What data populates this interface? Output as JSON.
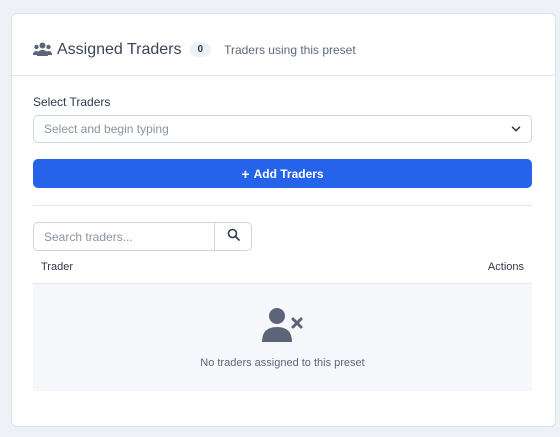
{
  "header": {
    "title": "Assigned Traders",
    "count": "0",
    "subtitle": "Traders using this preset",
    "icon": "users-icon"
  },
  "select_traders": {
    "label": "Select Traders",
    "placeholder": "Select and begin typing",
    "icon": "chevron-down-icon"
  },
  "add_button": {
    "label": "Add Traders",
    "icon": "plus-icon",
    "color": "#2563eb"
  },
  "search": {
    "placeholder": "Search traders...",
    "icon": "search-icon"
  },
  "table": {
    "columns": [
      "Trader",
      "Actions"
    ],
    "empty_message": "No traders assigned to this preset",
    "empty_icon": "user-remove-icon"
  }
}
